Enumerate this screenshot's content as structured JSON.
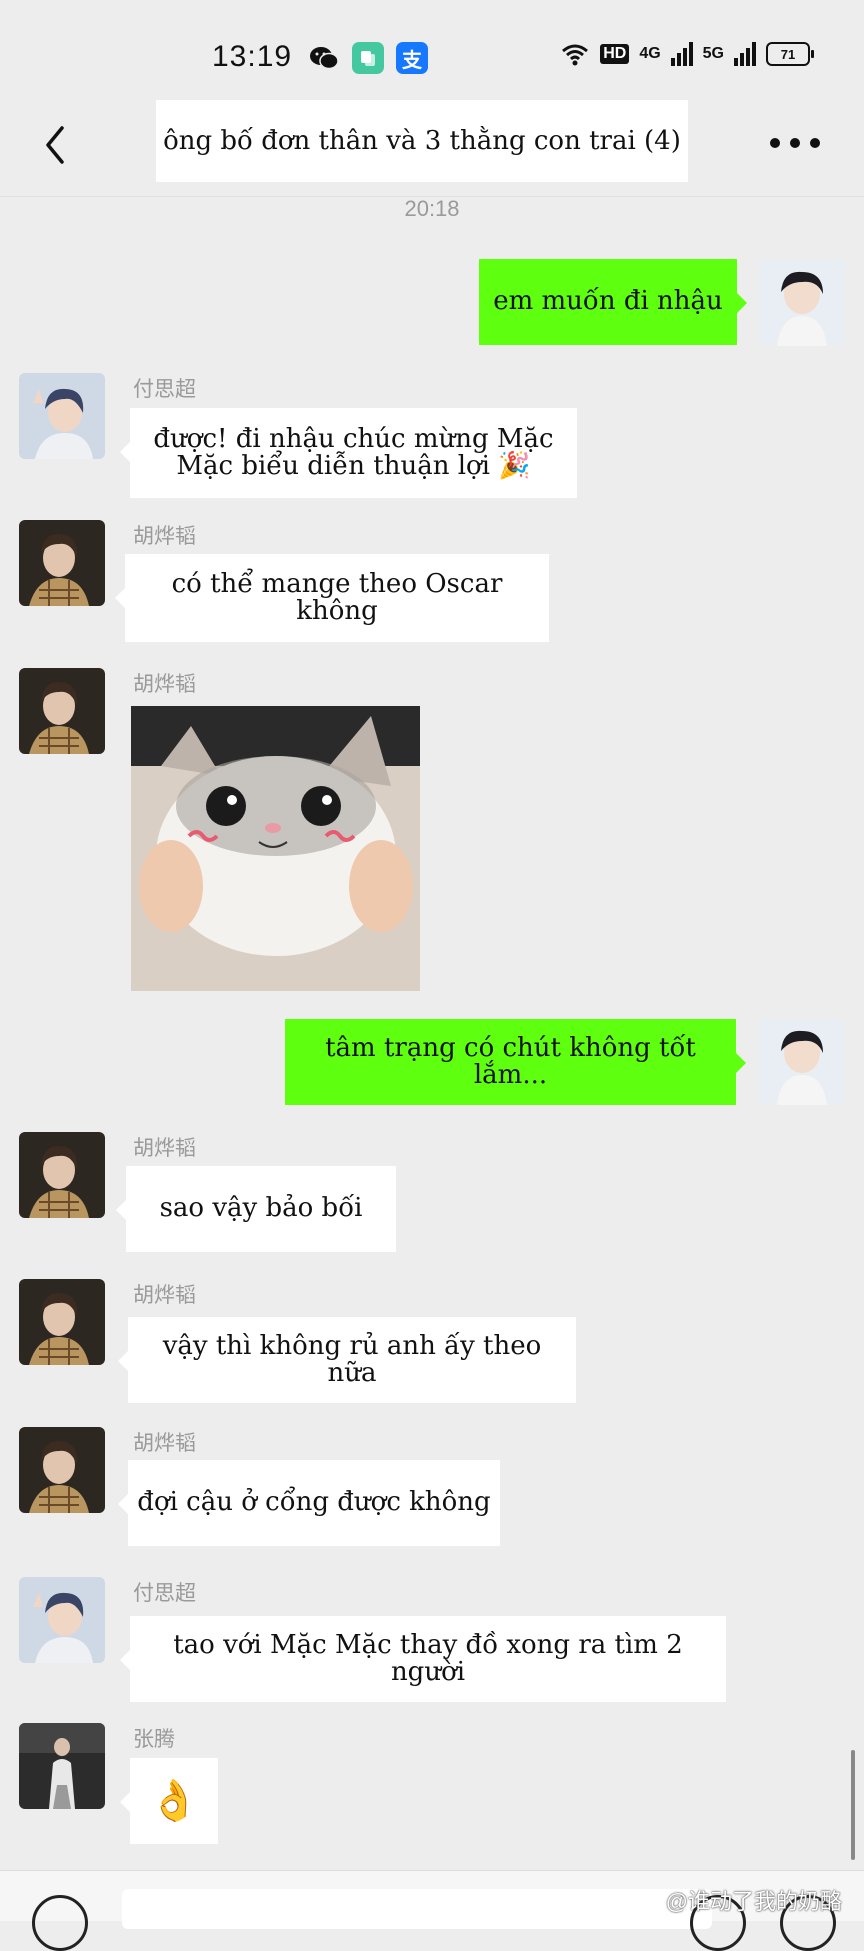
{
  "status_bar": {
    "time": "13:19",
    "app_icons": [
      "wechat-icon",
      "notes-icon",
      "alipay-icon"
    ],
    "network_hd": "HD",
    "network_4g": "4G",
    "network_5g": "5G",
    "battery": "71"
  },
  "header": {
    "title": "ông bố đơn thân và 3 thằng con trai (4)"
  },
  "time_divider": "20:18",
  "messages": [
    {
      "sender": "",
      "text": "em muốn đi nhậu",
      "direction": "out"
    },
    {
      "sender": "付思超",
      "text": "được! đi nhậu chúc mừng Mặc Mặc biểu diễn thuận lợi 🎉",
      "direction": "in"
    },
    {
      "sender": "胡烨韬",
      "text": "có thể mange theo Oscar không",
      "direction": "in"
    },
    {
      "sender": "胡烨韬",
      "text": "",
      "type": "sticker",
      "sticker": "cat-sticker",
      "direction": "in"
    },
    {
      "sender": "",
      "text": "tâm trạng có chút không tốt lắm...",
      "direction": "out"
    },
    {
      "sender": "胡烨韬",
      "text": "sao vậy bảo bối",
      "direction": "in"
    },
    {
      "sender": "胡烨韬",
      "text": "vậy thì không rủ anh ấy theo nữa",
      "direction": "in"
    },
    {
      "sender": "胡烨韬",
      "text": "đợi cậu ở cổng được không",
      "direction": "in"
    },
    {
      "sender": "付思超",
      "text": "tao với Mặc Mặc thay đồ xong ra tìm 2 người",
      "direction": "in"
    },
    {
      "sender": "张腾",
      "text": "👌",
      "direction": "in"
    }
  ],
  "watermark": "@谁动了我的奶酪",
  "colors": {
    "background": "#ededed",
    "outgoing_bubble": "#5fff10",
    "incoming_bubble": "#ffffff",
    "sender_name": "#9a9a9a"
  }
}
